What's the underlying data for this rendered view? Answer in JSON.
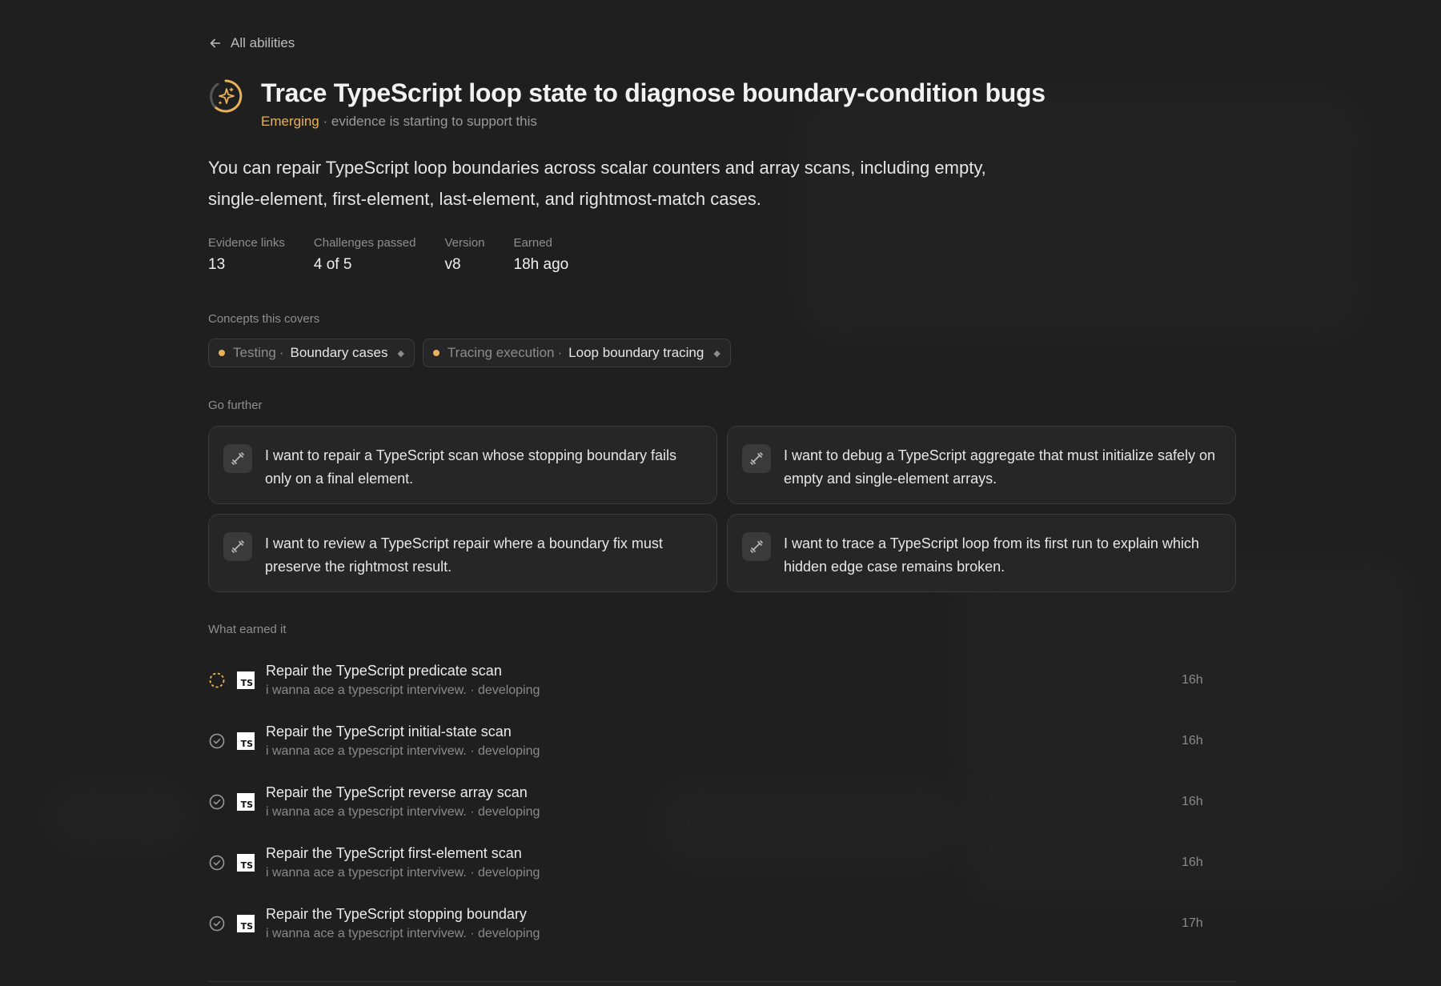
{
  "nav": {
    "back_label": "All abilities"
  },
  "ability": {
    "title": "Trace TypeScript loop state to diagnose boundary-condition bugs",
    "status": "Emerging",
    "status_note": " · evidence is starting to support this",
    "status_color": "#e8b25a",
    "description": "You can repair TypeScript loop boundaries across scalar counters and array scans, including empty, single-element, first-element, last-element, and rightmost-match cases."
  },
  "stats": [
    {
      "label": "Evidence links",
      "value": "13"
    },
    {
      "label": "Challenges passed",
      "value": "4 of 5"
    },
    {
      "label": "Version",
      "value": "v8"
    },
    {
      "label": "Earned",
      "value": "18h ago"
    }
  ],
  "concepts": {
    "label": "Concepts this covers",
    "items": [
      {
        "category": "Testing",
        "name": "Boundary cases"
      },
      {
        "category": "Tracing execution",
        "name": "Loop boundary tracing"
      }
    ]
  },
  "go_further": {
    "label": "Go further",
    "items": [
      {
        "text": "I want to repair a TypeScript scan whose stopping boundary fails only on a final element."
      },
      {
        "text": "I want to debug a TypeScript aggregate that must initialize safely on empty and single-element arrays."
      },
      {
        "text": "I want to review a TypeScript repair where a boundary fix must preserve the rightmost result."
      },
      {
        "text": "I want to trace a TypeScript loop from its first run to explain which hidden edge case remains broken."
      }
    ]
  },
  "earned": {
    "label": "What earned it",
    "items": [
      {
        "title": "Repair the TypeScript predicate scan",
        "subtitle": "i wanna ace a typescript intervivew. · developing",
        "time": "16h",
        "status": "in-progress"
      },
      {
        "title": "Repair the TypeScript initial-state scan",
        "subtitle": "i wanna ace a typescript intervivew. · developing",
        "time": "16h",
        "status": "passed"
      },
      {
        "title": "Repair the TypeScript reverse array scan",
        "subtitle": "i wanna ace a typescript intervivew. · developing",
        "time": "16h",
        "status": "passed"
      },
      {
        "title": "Repair the TypeScript first-element scan",
        "subtitle": "i wanna ace a typescript intervivew. · developing",
        "time": "16h",
        "status": "passed"
      },
      {
        "title": "Repair the TypeScript stopping boundary",
        "subtitle": "i wanna ace a typescript intervivew. · developing",
        "time": "17h",
        "status": "passed"
      }
    ],
    "language_badge": "TS"
  }
}
